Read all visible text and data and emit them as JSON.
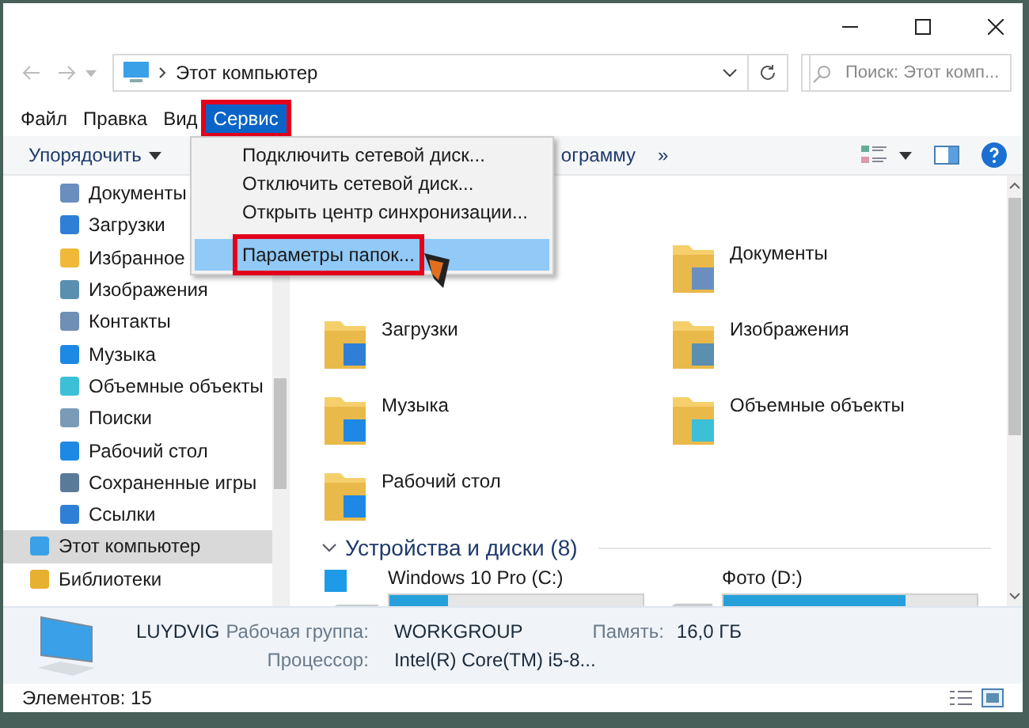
{
  "address_bar": {
    "path": "Этот компьютер",
    "search": {
      "placeholder": "Поиск: Этот комп..."
    }
  },
  "menu_bar": [
    {
      "label": "Файл",
      "selected": false,
      "highlighted": false
    },
    {
      "label": "Правка",
      "selected": false,
      "highlighted": false
    },
    {
      "label": "Вид",
      "selected": false,
      "highlighted": false
    },
    {
      "label": "Сервис",
      "selected": true,
      "highlighted": true
    }
  ],
  "dropdown_menu": [
    {
      "label": "Подключить сетевой диск...",
      "selected": false,
      "highlighted": false
    },
    {
      "label": "Отключить сетевой диск...",
      "selected": false,
      "highlighted": false
    },
    {
      "label": "Открыть центр синхронизации...",
      "selected": false,
      "highlighted": false
    },
    {
      "label": "Параметры папок...",
      "selected": true,
      "highlighted": true
    }
  ],
  "toolbar": [
    {
      "label": "Упорядочить",
      "dropdown": true
    },
    {
      "label": "ограмму",
      "dropdown": false
    },
    {
      "label": "»",
      "dropdown": false
    }
  ],
  "sidebar": {
    "quick_access_children": [
      {
        "label": "Документы",
        "kind": "document",
        "selected": false
      },
      {
        "label": "Загрузки",
        "kind": "download",
        "selected": false
      },
      {
        "label": "Избранное",
        "kind": "star",
        "selected": false
      },
      {
        "label": "Изображения",
        "kind": "picture",
        "selected": false
      },
      {
        "label": "Контакты",
        "kind": "contacts",
        "selected": false
      },
      {
        "label": "Музыка",
        "kind": "music",
        "selected": false
      },
      {
        "label": "Объемные объекты",
        "kind": "cube",
        "selected": false
      },
      {
        "label": "Поиски",
        "kind": "search",
        "selected": false
      },
      {
        "label": "Рабочий стол",
        "kind": "desktop",
        "selected": false
      },
      {
        "label": "Сохраненные игры",
        "kind": "games",
        "selected": false
      },
      {
        "label": "Ссылки",
        "kind": "link",
        "selected": false
      }
    ],
    "items": [
      {
        "label": "Этот компьютер",
        "kind": "computer",
        "selected": true
      },
      {
        "label": "Библиотеки",
        "kind": "library",
        "selected": false
      }
    ]
  },
  "folders": [
    {
      "label": "Документы",
      "kind": "document"
    },
    {
      "label": "Загрузки",
      "kind": "download"
    },
    {
      "label": "Изображения",
      "kind": "picture"
    },
    {
      "label": "Музыка",
      "kind": "music"
    },
    {
      "label": "Объемные объекты",
      "kind": "cube"
    },
    {
      "label": "Рабочий стол",
      "kind": "desktop"
    }
  ],
  "drives": {
    "section": "Устройства и диски (8)",
    "items": [
      {
        "label": "Windows 10 Pro (C:)",
        "kind": "system",
        "level": 0.23
      },
      {
        "label": "Фото  (D:)",
        "kind": "drive",
        "level": 0.72
      }
    ]
  },
  "details": {
    "name": "LUYDVIG",
    "fields": [
      {
        "label": "Рабочая группа:",
        "value": "WORKGROUP"
      },
      {
        "label": "Память:",
        "value": "16,0 ГБ"
      },
      {
        "label": "Процессор:",
        "value": "Intel(R) Core(TM) i5-8..."
      }
    ]
  },
  "status_bar": {
    "count": "Элементов: 15"
  }
}
